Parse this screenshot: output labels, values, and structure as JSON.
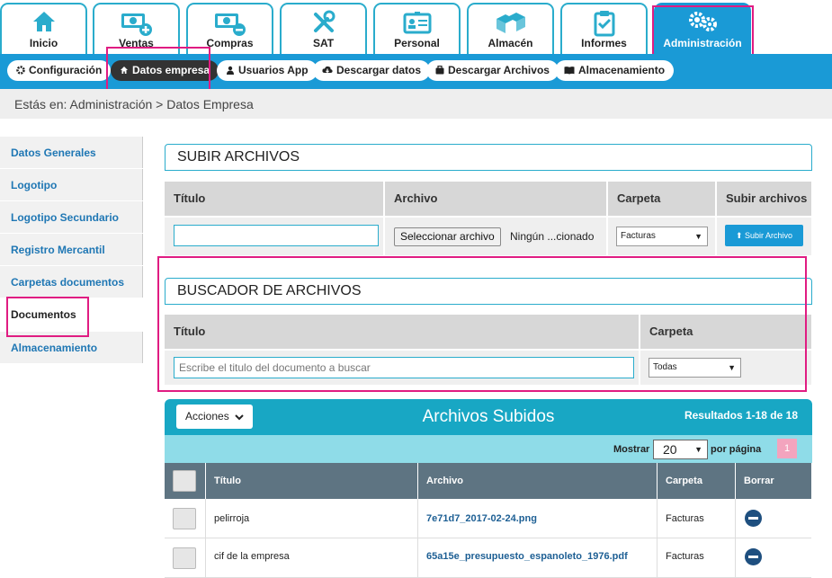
{
  "topnav": {
    "tabs": [
      {
        "label": "Inicio",
        "icon": "home-icon"
      },
      {
        "label": "Ventas",
        "icon": "cash-plus-icon"
      },
      {
        "label": "Compras",
        "icon": "cash-minus-icon"
      },
      {
        "label": "SAT",
        "icon": "tools-icon"
      },
      {
        "label": "Personal",
        "icon": "id-card-icon"
      },
      {
        "label": "Almacén",
        "icon": "boxes-icon"
      },
      {
        "label": "Informes",
        "icon": "clipboard-icon"
      },
      {
        "label": "Administración",
        "icon": "gears-icon"
      }
    ]
  },
  "subnav": {
    "items": [
      {
        "label": "Configuración",
        "icon": "gear-icon"
      },
      {
        "label": "Datos empresa",
        "icon": "home-icon"
      },
      {
        "label": "Usuarios App",
        "icon": "user-icon"
      },
      {
        "label": "Descargar datos",
        "icon": "cloud-download-icon"
      },
      {
        "label": "Descargar Archivos",
        "icon": "briefcase-icon"
      },
      {
        "label": "Almacenamiento",
        "icon": "book-icon"
      }
    ]
  },
  "breadcrumb": "Estás en: Administración > Datos Empresa",
  "sidebar": {
    "items": [
      "Datos Generales",
      "Logotipo",
      "Logotipo Secundario",
      "Registro Mercantil",
      "Carpetas documentos",
      "Documentos",
      "Almacenamiento"
    ]
  },
  "upload": {
    "title": "SUBIR ARCHIVOS",
    "headers": [
      "Título",
      "Archivo",
      "Carpeta",
      "Subir archivos"
    ],
    "file_button": "Seleccionar archivo",
    "file_status": "Ningún ...cionado",
    "folder_value": "Facturas",
    "submit_label": "Subir Archivo"
  },
  "search": {
    "title": "BUSCADOR DE ARCHIVOS",
    "headers": [
      "Título",
      "Carpeta"
    ],
    "placeholder": "Escribe el titulo del documento a buscar",
    "folder_value": "Todas"
  },
  "files": {
    "actions_label": "Acciones",
    "title": "Archivos Subidos",
    "results": "Resultados 1-18 de 18",
    "show_label": "Mostrar",
    "per_page_value": "20",
    "per_page_suffix": "por página",
    "page_number": "1",
    "columns": [
      "Título",
      "Archivo",
      "Carpeta",
      "Borrar"
    ],
    "rows": [
      {
        "title": "pelirroja",
        "file": "7e71d7_2017-02-24.png",
        "folder": "Facturas"
      },
      {
        "title": "cif de la empresa",
        "file": "65a15e_presupuesto_espanoleto_1976.pdf",
        "folder": "Facturas"
      }
    ]
  },
  "colors": {
    "accent": "#1a9ad6",
    "teal": "#18a7c4",
    "highlight": "#e01c82"
  }
}
